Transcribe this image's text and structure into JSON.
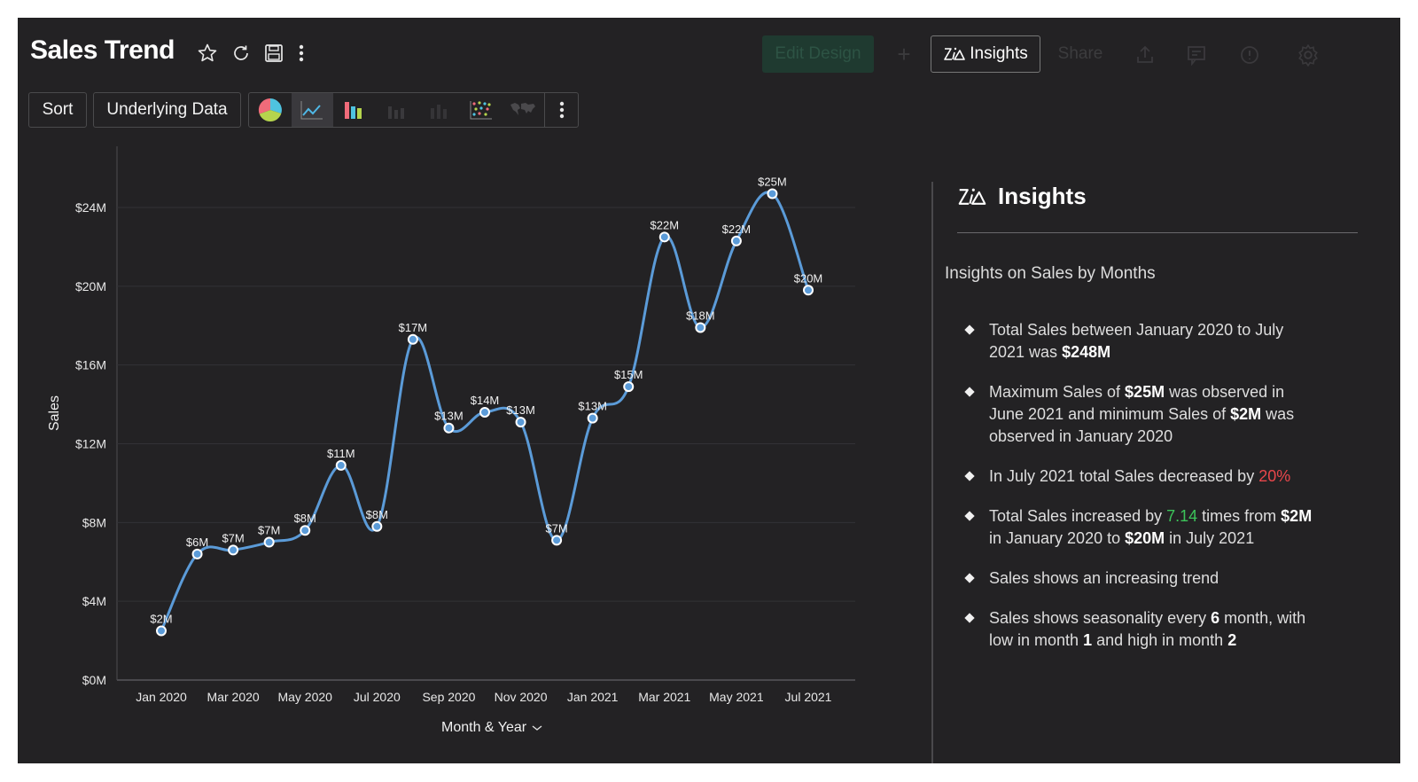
{
  "header": {
    "title": "Sales Trend",
    "icons": [
      "star-icon",
      "refresh-icon",
      "save-icon",
      "more-vertical-icon"
    ],
    "edit_design_label": "Edit Design",
    "add_label": "+",
    "insights_label": "Insights",
    "share_label": "Share",
    "right_icons": [
      "export-icon",
      "comment-icon",
      "alert-icon",
      "settings-icon"
    ]
  },
  "toolbar": {
    "sort_label": "Sort",
    "underlying_data_label": "Underlying Data",
    "chart_types": [
      "pie-chart",
      "line-chart",
      "bar-chart",
      "stacked-bar-chart",
      "combination-chart",
      "scatter-chart",
      "map-chart"
    ],
    "active_chart_type": "line-chart"
  },
  "colors": {
    "background": "#232224",
    "line": "#5b9bd8",
    "positive": "#3cc45a",
    "negative": "#e8474b"
  },
  "chart_data": {
    "type": "line",
    "title": "Sales Trend",
    "xlabel": "Month & Year",
    "ylabel": "Sales",
    "ylim": [
      0,
      24
    ],
    "yunit": "M",
    "yticks": [
      0,
      4,
      8,
      12,
      16,
      20,
      24
    ],
    "ytick_labels": [
      "$0M",
      "$4M",
      "$8M",
      "$12M",
      "$16M",
      "$20M",
      "$24M"
    ],
    "grid": true,
    "x": [
      "Jan 2020",
      "Feb 2020",
      "Mar 2020",
      "Apr 2020",
      "May 2020",
      "Jun 2020",
      "Jul 2020",
      "Aug 2020",
      "Sep 2020",
      "Oct 2020",
      "Nov 2020",
      "Dec 2020",
      "Jan 2021",
      "Feb 2021",
      "Mar 2021",
      "Apr 2021",
      "May 2021",
      "Jun 2021",
      "Jul 2021"
    ],
    "xtick_labels": [
      "Jan 2020",
      "Mar 2020",
      "May 2020",
      "Jul 2020",
      "Sep 2020",
      "Nov 2020",
      "Jan 2021",
      "Mar 2021",
      "May 2021",
      "Jul 2021"
    ],
    "series": [
      {
        "name": "Sales",
        "values": [
          2.5,
          6.4,
          6.6,
          7.0,
          7.6,
          10.9,
          7.8,
          17.3,
          12.8,
          13.6,
          13.1,
          7.1,
          13.3,
          14.9,
          22.5,
          17.9,
          22.3,
          24.7,
          19.8
        ],
        "labels": [
          "$2M",
          "$6M",
          "$7M",
          "$7M",
          "$8M",
          "$11M",
          "$8M",
          "$17M",
          "$13M",
          "$14M",
          "$13M",
          "$7M",
          "$13M",
          "$15M",
          "$22M",
          "$18M",
          "$22M",
          "$25M",
          "$20M"
        ]
      }
    ]
  },
  "insights": {
    "title": "Insights",
    "subtitle": "Insights on Sales by Months",
    "items": [
      {
        "parts": [
          {
            "t": "Total Sales between January 2020 to July 2021 was "
          },
          {
            "t": "$248M",
            "b": true
          }
        ]
      },
      {
        "parts": [
          {
            "t": "Maximum Sales of "
          },
          {
            "t": "$25M",
            "b": true
          },
          {
            "t": " was observed in June 2021 and minimum Sales of "
          },
          {
            "t": "$2M",
            "b": true
          },
          {
            "t": " was observed in January 2020"
          }
        ]
      },
      {
        "parts": [
          {
            "t": "In July 2021 total Sales decreased by "
          },
          {
            "t": "20%",
            "c": "red"
          }
        ]
      },
      {
        "parts": [
          {
            "t": "Total Sales increased by "
          },
          {
            "t": "7.14",
            "c": "green"
          },
          {
            "t": " times from "
          },
          {
            "t": "$2M",
            "b": true
          },
          {
            "t": " in January 2020 to "
          },
          {
            "t": "$20M",
            "b": true
          },
          {
            "t": " in July 2021"
          }
        ]
      },
      {
        "parts": [
          {
            "t": "Sales shows an increasing trend"
          }
        ]
      },
      {
        "parts": [
          {
            "t": "Sales shows seasonality every "
          },
          {
            "t": "6",
            "b": true
          },
          {
            "t": " month, with low in month "
          },
          {
            "t": "1",
            "b": true
          },
          {
            "t": " and high in month "
          },
          {
            "t": "2",
            "b": true
          }
        ]
      }
    ]
  }
}
